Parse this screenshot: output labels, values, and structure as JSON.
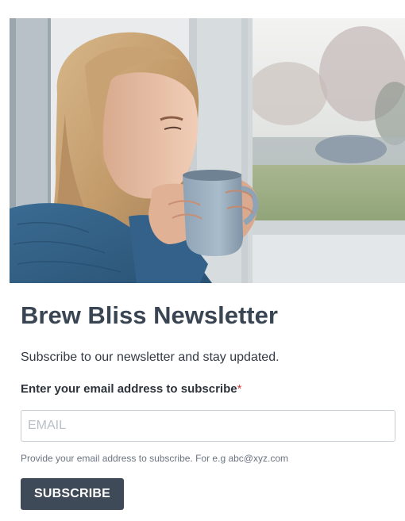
{
  "hero": {
    "image_name": "woman-drinking-coffee-by-window-photo"
  },
  "newsletter": {
    "title": "Brew Bliss Newsletter",
    "subtitle": "Subscribe to our newsletter and stay updated.",
    "field_label": "Enter your email address to subscribe",
    "required_mark": "*",
    "email_placeholder": "EMAIL",
    "email_value": "",
    "help_text": "Provide your email address to subscribe. For e.g abc@xyz.com",
    "button_label": "SUBSCRIBE"
  },
  "colors": {
    "title": "#3a4553",
    "button_bg": "#3f4a58",
    "button_text": "#ffffff",
    "required": "#d83b3b",
    "input_border": "#c9ced4",
    "placeholder": "#b9c0c8"
  }
}
